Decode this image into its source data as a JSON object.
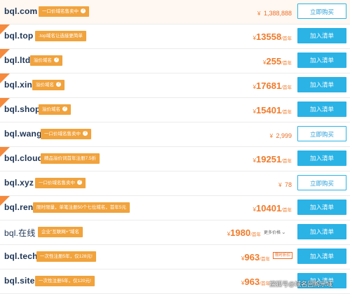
{
  "rows": [
    {
      "domain": "bql.com",
      "tag": "一口价域名售卖中",
      "tag_icon": "question-icon",
      "yen": "¥",
      "price": "1,388,888",
      "unit": "",
      "button": "立即购买",
      "button_type": "buy",
      "price_style": "small",
      "corner": false
    },
    {
      "domain": "bql.top",
      "tag": ".top域名让选接更简单",
      "tag_icon": "",
      "yen": "¥",
      "price": "13558",
      "unit": "/首年",
      "button": "加入清单",
      "button_type": "cart",
      "price_style": "big",
      "corner": true
    },
    {
      "domain": "bql.ltd",
      "tag": "溢价域名",
      "tag_icon": "question-icon",
      "yen": "¥",
      "price": "255",
      "unit": "/首年",
      "button": "加入清单",
      "button_type": "cart",
      "price_style": "big",
      "corner": true
    },
    {
      "domain": "bql.xin",
      "tag": "溢价域名",
      "tag_icon": "question-icon",
      "yen": "¥",
      "price": "17681",
      "unit": "/首年",
      "button": "加入清单",
      "button_type": "cart",
      "price_style": "big",
      "corner": true
    },
    {
      "domain": "bql.shop",
      "tag": "溢价域名",
      "tag_icon": "question-icon",
      "yen": "¥",
      "price": "15401",
      "unit": "/首年",
      "button": "加入清单",
      "button_type": "cart",
      "price_style": "big",
      "corner": true
    },
    {
      "domain": "bql.wang",
      "tag": "一口价域名售卖中",
      "tag_icon": "question-icon",
      "yen": "¥",
      "price": "2,999",
      "unit": "",
      "button": "立即购买",
      "button_type": "buy",
      "price_style": "small",
      "corner": false
    },
    {
      "domain": "bql.cloud",
      "tag": "精品溢价词首年注册7.5折",
      "tag_icon": "",
      "yen": "¥",
      "price": "19251",
      "unit": "/首年",
      "button": "加入清单",
      "button_type": "cart",
      "price_style": "big",
      "corner": true
    },
    {
      "domain": "bql.xyz",
      "tag": "一口价域名售卖中",
      "tag_icon": "question-icon",
      "yen": "¥",
      "price": "78",
      "unit": "",
      "button": "立即购买",
      "button_type": "buy",
      "price_style": "small",
      "corner": false
    },
    {
      "domain": "bql.ren",
      "tag": "限时限量，单笔注册50个七位域名，首年5元",
      "tag_icon": "",
      "yen": "¥",
      "price": "10401",
      "unit": "/首年",
      "button": "加入清单",
      "button_type": "cart",
      "price_style": "big",
      "corner": true
    },
    {
      "domain": "bql.在线",
      "tag": "企业\"互联网+\"域名",
      "tag_icon": "",
      "yen": "¥",
      "price": "1980",
      "unit": "/首年",
      "button": "加入清单",
      "button_type": "cart",
      "price_style": "big",
      "corner": false,
      "more": "更多价格"
    },
    {
      "domain": "bql.tech",
      "tag": "一次性注册5年，仅128元!",
      "tag_icon": "",
      "yen": "¥",
      "price": "963",
      "unit": "/首年",
      "button": "加入清单",
      "button_type": "cart",
      "price_style": "big",
      "corner": false,
      "promo": "限时折扣"
    },
    {
      "domain": "bql.site",
      "tag": "一次性注册5年，仅120元!",
      "tag_icon": "",
      "yen": "¥",
      "price": "963",
      "unit": "/首年",
      "button": "加入清单",
      "button_type": "cart",
      "price_style": "big",
      "corner": false
    }
  ],
  "watermark": "搜狐号@域名回购乐域",
  "colors": {
    "accent": "#2bb3e6",
    "price": "#f07a2a",
    "tag": "#f1a33d",
    "domain": "#1e3555"
  }
}
